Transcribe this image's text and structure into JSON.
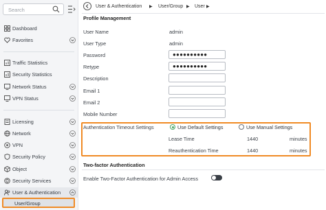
{
  "sidebar": {
    "search_placeholder": "Search",
    "items": [
      {
        "label": "Dashboard",
        "icon": "dashboard-icon"
      },
      {
        "label": "Favorites",
        "icon": "heart-icon"
      },
      {
        "label": "Traffic Statistics",
        "icon": "chart-icon"
      },
      {
        "label": "Security Statistics",
        "icon": "chart-icon"
      },
      {
        "label": "Network Status",
        "icon": "monitor-icon"
      },
      {
        "label": "VPN Status",
        "icon": "monitor-icon"
      },
      {
        "label": "Licensing",
        "icon": "license-icon"
      },
      {
        "label": "Network",
        "icon": "globe-icon"
      },
      {
        "label": "VPN",
        "icon": "vpn-icon"
      },
      {
        "label": "Security Policy",
        "icon": "shield-icon"
      },
      {
        "label": "Object",
        "icon": "cube-icon"
      },
      {
        "label": "Security Services",
        "icon": "services-icon"
      },
      {
        "label": "User & Authentication",
        "icon": "user-icon"
      }
    ],
    "sub_item": "User/Group"
  },
  "breadcrumb": [
    "User & Authentication",
    "User/Group",
    "User"
  ],
  "profile": {
    "title": "Profile Management",
    "user_name_label": "User Name",
    "user_name_value": "admin",
    "user_type_label": "User Type",
    "user_type_value": "admin",
    "password_label": "Password",
    "password_value": "●●●●●●●●●●",
    "retype_label": "Retype",
    "retype_value": "●●●●●●●●●●",
    "description_label": "Description",
    "email1_label": "Email 1",
    "email2_label": "Email 2",
    "mobile_label": "Mobile Number"
  },
  "auth_timeout": {
    "label": "Authentication Timeout Settings",
    "option_default": "Use Default Settings",
    "option_manual": "Use Manual Settings",
    "selected": "default",
    "lease_label": "Lease Time",
    "lease_value": "1440",
    "reauth_label": "Reauthentication Time",
    "reauth_value": "1440",
    "unit": "minutes"
  },
  "two_factor": {
    "title": "Two-factor Authentication",
    "enable_label": "Enable Two-Factor Authentication for Admin Access",
    "enabled": false
  },
  "colors": {
    "highlight": "#f08a24",
    "radio_on": "#4aa564"
  }
}
